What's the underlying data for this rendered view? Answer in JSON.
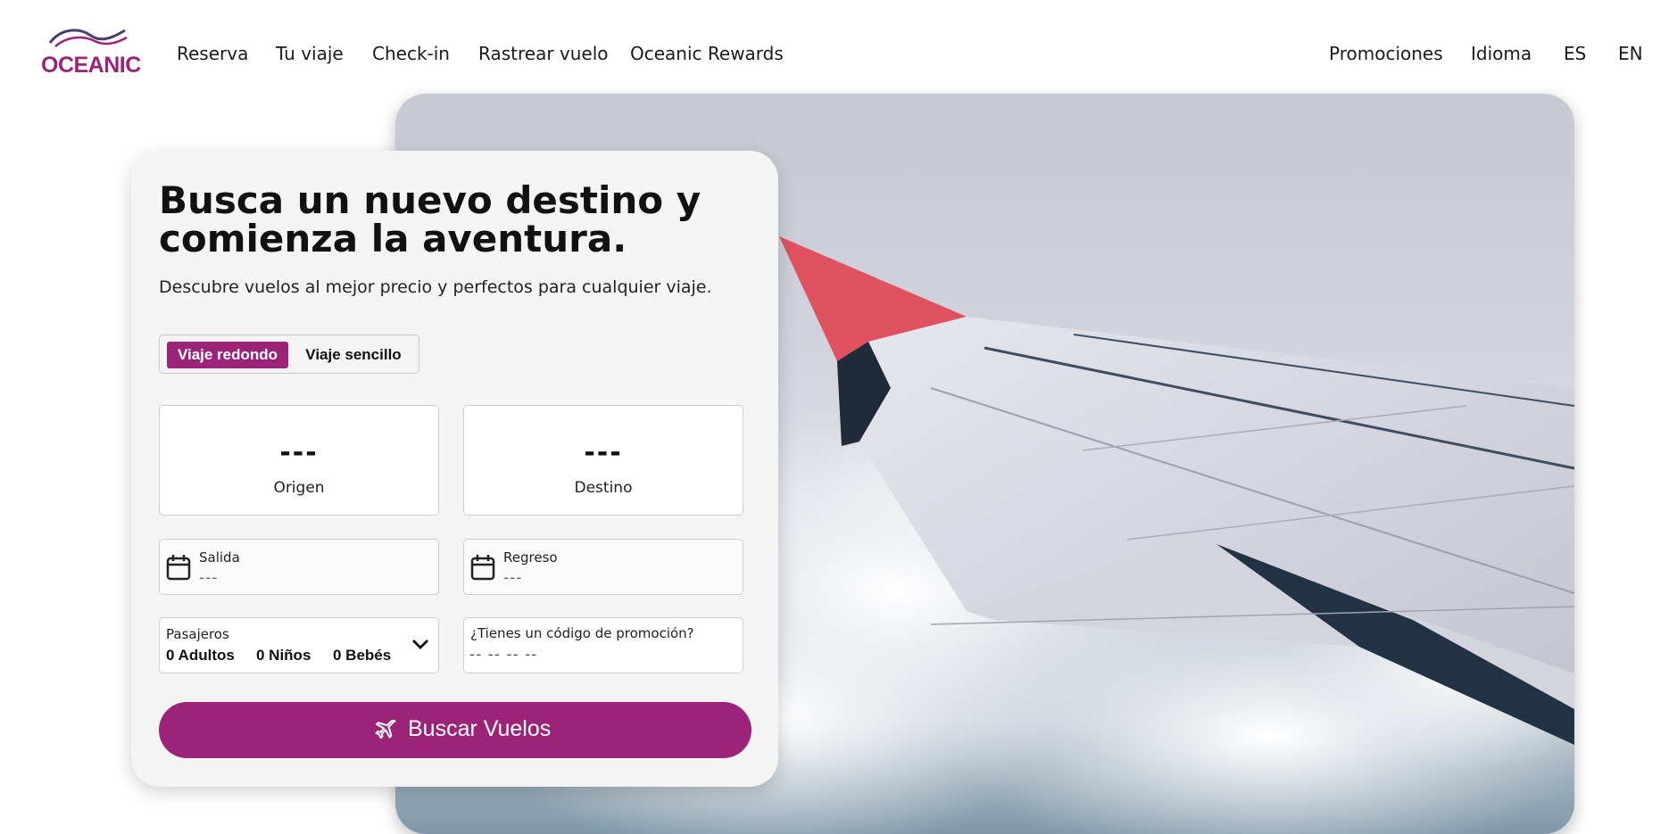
{
  "brand": {
    "logo_text": "OCEANIC",
    "accent_color": "#9b2478"
  },
  "nav": {
    "left": [
      "Reserva",
      "Tu viaje",
      "Check-in",
      "Rastrear vuelo",
      "Oceanic Rewards"
    ],
    "right": [
      "Promociones",
      "Idioma",
      "ES",
      "EN"
    ]
  },
  "hero": {
    "image": "airplane-wing-above-clouds"
  },
  "search": {
    "title": "Busca un nuevo destino y comienza la aventura.",
    "subtitle": "Descubre vuelos al mejor precio y perfectos para cualquier viaje.",
    "trip_types": [
      "Viaje redondo",
      "Viaje sencillo"
    ],
    "selected_trip": "Viaje redondo",
    "origin": {
      "code": "---",
      "label": "Origen"
    },
    "destination": {
      "code": "---",
      "label": "Destino"
    },
    "departure": {
      "label": "Salida",
      "value": "---"
    },
    "return": {
      "label": "Regreso",
      "value": "---"
    },
    "passengers": {
      "label": "Pasajeros",
      "adults": "0 Adultos",
      "children": "0 Niños",
      "infants": "0 Bebés"
    },
    "promo": {
      "label": "¿Tienes un código de promoción?",
      "placeholder": "-- -- -- --"
    },
    "submit_label": "Buscar Vuelos"
  }
}
